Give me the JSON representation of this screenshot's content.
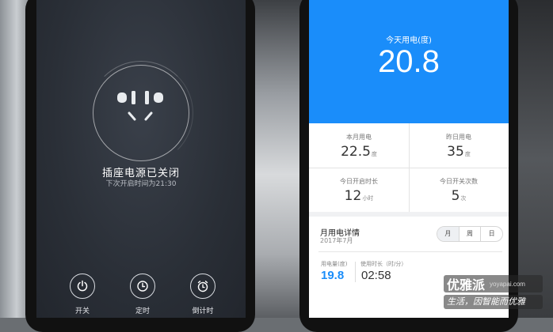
{
  "left_screen": {
    "status_title": "插座电源已关闭",
    "status_sub": "下次开启时间为21:30",
    "controls": [
      {
        "label": "开关",
        "icon": "power-icon"
      },
      {
        "label": "定时",
        "icon": "clock-icon"
      },
      {
        "label": "倒计时",
        "icon": "alarm-clock-icon"
      }
    ]
  },
  "right_screen": {
    "accent": "#1a8dfa",
    "today_label": "今天用电(度)",
    "today_value": "20.8",
    "stats": [
      {
        "label": "本月用电",
        "value": "22.5",
        "unit": "度"
      },
      {
        "label": "昨日用电",
        "value": "35",
        "unit": "度"
      },
      {
        "label": "今日开启时长",
        "value": "12",
        "unit": "小时"
      },
      {
        "label": "今日开关次数",
        "value": "5",
        "unit": "次"
      }
    ],
    "detail": {
      "title": "月用电详情",
      "subtitle": "2017年7月",
      "tabs": [
        "月",
        "周",
        "日"
      ],
      "selected_tab": "月",
      "usage_label": "用电量(度)",
      "usage_value": "19.8",
      "time_label": "使用时长（时/分）",
      "time_value": "02:58"
    }
  },
  "watermark": {
    "brand": "优雅派",
    "site": "yoyapai.com",
    "slogan": "生活，因智能而优雅"
  }
}
